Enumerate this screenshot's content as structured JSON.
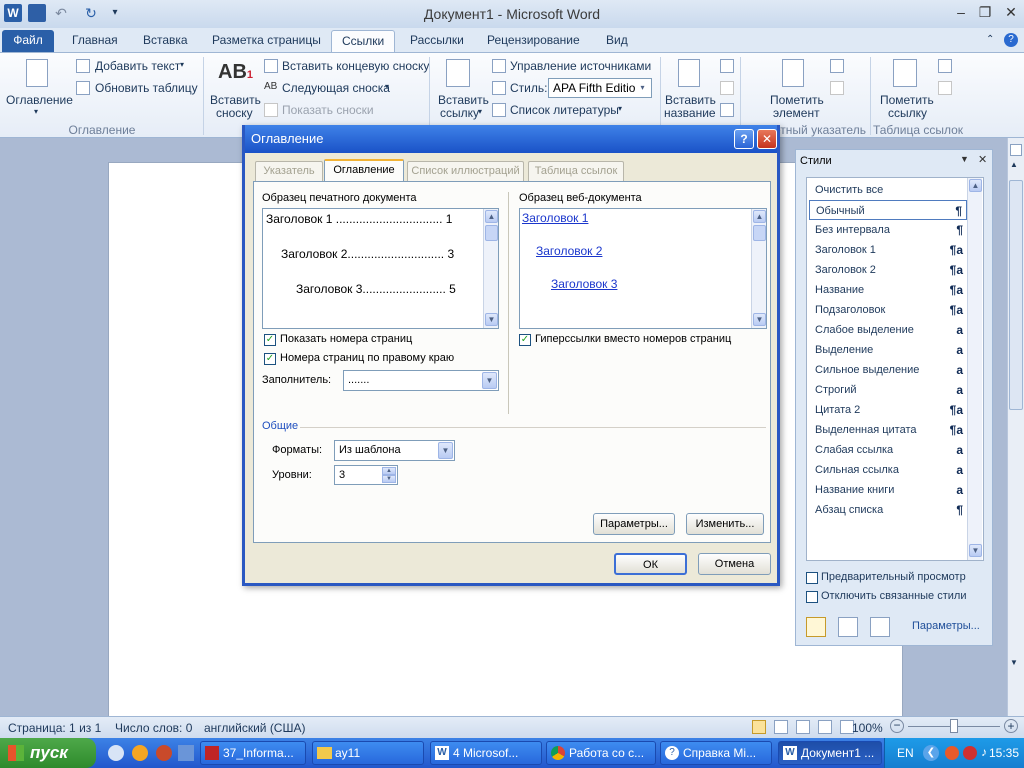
{
  "window": {
    "title": "Документ1 - Microsoft Word",
    "minimize": "–",
    "maximize": "❐",
    "close": "✕"
  },
  "tabs": {
    "file": "Файл",
    "items": [
      "Главная",
      "Вставка",
      "Разметка страницы",
      "Ссылки",
      "Рассылки",
      "Рецензирование",
      "Вид"
    ]
  },
  "ribbon": {
    "toc_button": "Оглавление",
    "add_text": "Добавить текст",
    "update_table": "Обновить таблицу",
    "group_toc": "Оглавление",
    "insert_footnote_line1": "Вставить",
    "insert_footnote_line2": "сноску",
    "insert_endnote": "Вставить концевую сноску",
    "next_footnote": "Следующая сноска",
    "show_notes": "Показать сноски",
    "insert_citation_line1": "Вставить",
    "insert_citation_line2": "ссылку",
    "manage_sources": "Управление источниками",
    "style_label": "Стиль:",
    "style_value": "APA Fifth Edition",
    "bibliography": "Список литературы",
    "insert_caption_line1": "Вставить",
    "insert_caption_line2": "название",
    "mark_entry_line1": "Пометить",
    "mark_entry_line2": "элемент",
    "group_index": "етный указатель",
    "mark_citation_line1": "Пометить",
    "mark_citation_line2": "ссылку",
    "group_toa": "Таблица ссылок"
  },
  "dialog": {
    "title": "Оглавление",
    "help": "?",
    "close": "✕",
    "tabs": [
      "Указатель",
      "Оглавление",
      "Список иллюстраций",
      "Таблица ссылок"
    ],
    "print_preview_label": "Образец печатного документа",
    "print_preview": [
      "Заголовок 1 ................................ 1",
      "Заголовок 2............................. 3",
      "Заголовок 3......................... 5"
    ],
    "web_preview_label": "Образец веб-документа",
    "web_preview": [
      "Заголовок 1",
      "Заголовок 2",
      "Заголовок 3"
    ],
    "show_page_numbers": "Показать номера страниц",
    "right_align": "Номера страниц по правому краю",
    "hyperlinks": "Гиперссылки вместо номеров страниц",
    "leader_label": "Заполнитель:",
    "leader_value": ".......",
    "general_label": "Общие",
    "formats_label": "Форматы:",
    "formats_value": "Из шаблона",
    "levels_label": "Уровни:",
    "levels_value": "3",
    "options_button": "Параметры...",
    "modify_button": "Изменить...",
    "ok_button": "ОК",
    "cancel_button": "Отмена"
  },
  "styles_pane": {
    "title": "Стили",
    "items": [
      {
        "name": "Очистить все",
        "mark": ""
      },
      {
        "name": "Обычный",
        "mark": "¶"
      },
      {
        "name": "Без интервала",
        "mark": "¶"
      },
      {
        "name": "Заголовок 1",
        "mark": "¶a"
      },
      {
        "name": "Заголовок 2",
        "mark": "¶a"
      },
      {
        "name": "Название",
        "mark": "¶a"
      },
      {
        "name": "Подзаголовок",
        "mark": "¶a"
      },
      {
        "name": "Слабое выделение",
        "mark": "a"
      },
      {
        "name": "Выделение",
        "mark": "a"
      },
      {
        "name": "Сильное выделение",
        "mark": "a"
      },
      {
        "name": "Строгий",
        "mark": "a"
      },
      {
        "name": "Цитата 2",
        "mark": "¶a"
      },
      {
        "name": "Выделенная цитата",
        "mark": "¶a"
      },
      {
        "name": "Слабая ссылка",
        "mark": "a"
      },
      {
        "name": "Сильная ссылка",
        "mark": "a"
      },
      {
        "name": "Название книги",
        "mark": "a"
      },
      {
        "name": "Абзац списка",
        "mark": "¶"
      }
    ],
    "preview": "Предварительный просмотр",
    "disable_linked": "Отключить связанные стили",
    "options": "Параметры..."
  },
  "status": {
    "page": "Страница: 1 из 1",
    "words": "Число слов: 0",
    "language": "английский (США)",
    "zoom": "100%"
  },
  "taskbar": {
    "start": "пуск",
    "items": [
      "37_Informa...",
      "ay11",
      "4 Microsof...",
      "Работа со с...",
      "Справка Mi...",
      "Документ1 ..."
    ],
    "lang": "EN",
    "time": "15:35"
  },
  "colors": {
    "dialog_title": "#1a52c7",
    "file_tab": "#2a5fa8",
    "taskbar": "#2257cc",
    "start": "#3f9a3c"
  }
}
